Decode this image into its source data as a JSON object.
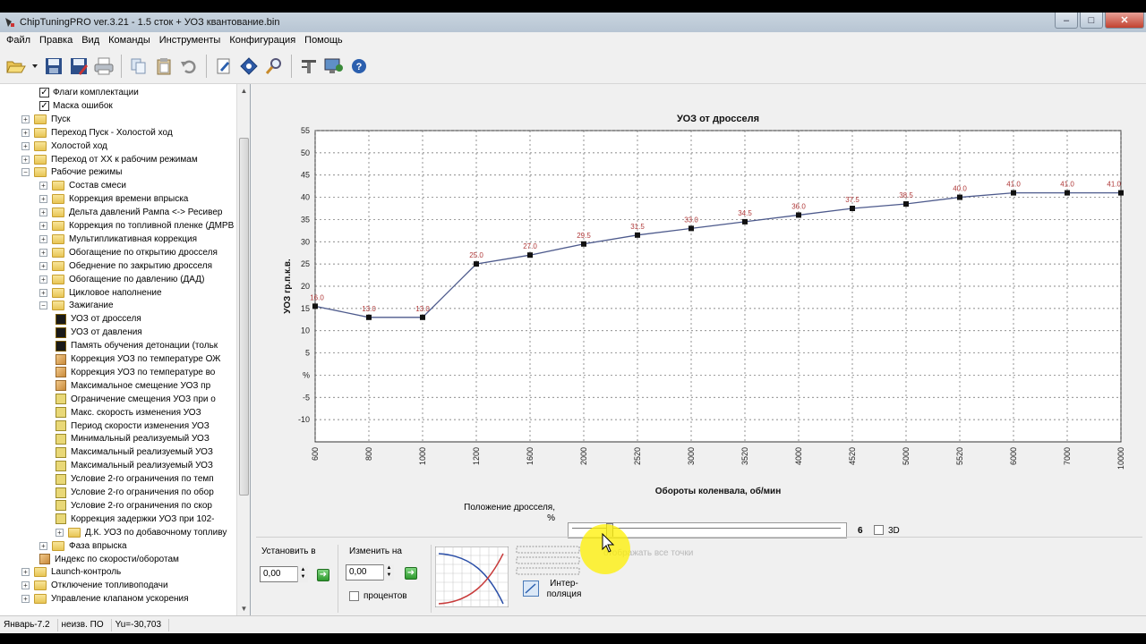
{
  "window": {
    "title": "ChipTuningPRO ver.3.21 - 1.5 сток + УОЗ квантование.bin",
    "min_label": "–",
    "max_label": "□",
    "close_label": "✕"
  },
  "menu": [
    "Файл",
    "Правка",
    "Вид",
    "Команды",
    "Инструменты",
    "Конфигурация",
    "Помощь"
  ],
  "toolbar": {
    "icons": [
      "open-icon",
      "save-icon",
      "save-as-icon",
      "print-icon",
      "copy-icon",
      "paste-icon",
      "undo-icon",
      "edit-icon",
      "diamond-icon",
      "search-icon",
      "tools-icon",
      "monitor-icon",
      "help-icon"
    ]
  },
  "tree": {
    "items": [
      {
        "level": 2,
        "kind": "check",
        "label": "Флаги комплектации",
        "expander": ""
      },
      {
        "level": 2,
        "kind": "check",
        "label": "Маска ошибок",
        "expander": ""
      },
      {
        "level": 1,
        "kind": "folder",
        "label": "Пуск",
        "expander": "+"
      },
      {
        "level": 1,
        "kind": "folder",
        "label": "Переход Пуск - Холостой ход",
        "expander": "+"
      },
      {
        "level": 1,
        "kind": "folder",
        "label": "Холостой ход",
        "expander": "+"
      },
      {
        "level": 1,
        "kind": "folder",
        "label": "Переход от ХХ к рабочим режимам",
        "expander": "+"
      },
      {
        "level": 1,
        "kind": "folder",
        "label": "Рабочие режимы",
        "expander": "−"
      },
      {
        "level": 2,
        "kind": "folder",
        "label": "Состав смеси",
        "expander": "+"
      },
      {
        "level": 2,
        "kind": "folder",
        "label": "Коррекция времени впрыска",
        "expander": "+"
      },
      {
        "level": 2,
        "kind": "folder",
        "label": "Дельта давлений Рампа <-> Ресивер",
        "expander": "+"
      },
      {
        "level": 2,
        "kind": "folder",
        "label": "Коррекция по топливной пленке (ДМРВ",
        "expander": "+"
      },
      {
        "level": 2,
        "kind": "folder",
        "label": "Мультипликативная коррекция",
        "expander": "+"
      },
      {
        "level": 2,
        "kind": "folder",
        "label": "Обогащение по открытию дросселя",
        "expander": "+"
      },
      {
        "level": 2,
        "kind": "folder",
        "label": "Обеднение по закрытию дросселя",
        "expander": "+"
      },
      {
        "level": 2,
        "kind": "folder",
        "label": "Обогащение по давлению (ДАД)",
        "expander": "+"
      },
      {
        "level": 2,
        "kind": "folder",
        "label": "Цикловое наполнение",
        "expander": "+"
      },
      {
        "level": 2,
        "kind": "folder",
        "label": "Зажигание",
        "expander": "−"
      },
      {
        "level": 3,
        "kind": "map",
        "label": "УОЗ от дросселя",
        "expander": ""
      },
      {
        "level": 3,
        "kind": "map",
        "label": "УОЗ от давления",
        "expander": ""
      },
      {
        "level": 3,
        "kind": "map",
        "label": "Память обучения детонации (тольк",
        "expander": ""
      },
      {
        "level": 3,
        "kind": "table",
        "label": "Коррекция УОЗ по температуре ОЖ",
        "expander": ""
      },
      {
        "level": 3,
        "kind": "table",
        "label": "Коррекция УОЗ по температуре во",
        "expander": ""
      },
      {
        "level": 3,
        "kind": "table",
        "label": "Максимальное смещение УОЗ пр",
        "expander": ""
      },
      {
        "level": 3,
        "kind": "const",
        "label": "Ограничение смещения УОЗ при о",
        "expander": ""
      },
      {
        "level": 3,
        "kind": "const",
        "label": "Макс. скорость изменения УОЗ",
        "expander": ""
      },
      {
        "level": 3,
        "kind": "const",
        "label": "Период скорости изменения УОЗ",
        "expander": ""
      },
      {
        "level": 3,
        "kind": "const",
        "label": "Минимальный реализуемый УОЗ",
        "expander": ""
      },
      {
        "level": 3,
        "kind": "const",
        "label": "Максимальный реализуемый УОЗ",
        "expander": ""
      },
      {
        "level": 3,
        "kind": "const",
        "label": "Максимальный реализуемый УОЗ",
        "expander": ""
      },
      {
        "level": 3,
        "kind": "const",
        "label": "Условие 2-го ограничения по темп",
        "expander": ""
      },
      {
        "level": 3,
        "kind": "const",
        "label": "Условие 2-го ограничения по обор",
        "expander": ""
      },
      {
        "level": 3,
        "kind": "const",
        "label": "Условие 2-го ограничения по скор",
        "expander": ""
      },
      {
        "level": 3,
        "kind": "const",
        "label": "Коррекция задержки УОЗ при 102-",
        "expander": ""
      },
      {
        "level": 3,
        "kind": "folder",
        "label": "Д.К. УОЗ по добавочному топливу",
        "expander": "+"
      },
      {
        "level": 2,
        "kind": "folder",
        "label": "Фаза впрыска",
        "expander": "+"
      },
      {
        "level": 2,
        "kind": "table",
        "label": "Индекс по скорости/оборотам",
        "expander": ""
      },
      {
        "level": 1,
        "kind": "folder",
        "label": "Launch-контроль",
        "expander": "+"
      },
      {
        "level": 1,
        "kind": "folder",
        "label": "Отключение топливоподачи",
        "expander": "+"
      },
      {
        "level": 1,
        "kind": "folder",
        "label": "Управление клапаном ускорения",
        "expander": "+"
      }
    ]
  },
  "chart_data": {
    "type": "line",
    "title": "УОЗ от дросселя",
    "xlabel": "Обороты коленвала, об/мин",
    "ylabel": "УОЗ гр.п.к.в.",
    "categories": [
      "600",
      "800",
      "1000",
      "1200",
      "1600",
      "2000",
      "2520",
      "3000",
      "3520",
      "4000",
      "4520",
      "5000",
      "5520",
      "6000",
      "7000",
      "10000"
    ],
    "values": [
      15.5,
      13.0,
      13.0,
      25.0,
      27.0,
      29.5,
      31.5,
      33.0,
      34.5,
      36.0,
      37.5,
      38.5,
      40.0,
      41.0,
      41.0,
      41.0
    ],
    "point_labels": [
      "16.0",
      "13.0",
      "13.0",
      "25.0",
      "27.0",
      "29.5",
      "31.5",
      "33.0",
      "34.5",
      "36.0",
      "37.5",
      "38.5",
      "40.0",
      "41.0",
      "41.0",
      "41.0"
    ],
    "yticks": [
      "55",
      "50",
      "45",
      "40",
      "35",
      "30",
      "25",
      "20",
      "15",
      "10",
      "5",
      "%",
      "-5",
      "-10"
    ],
    "ylim": [
      -15,
      55
    ],
    "grid": true,
    "line_color": "#4d5a8c",
    "label_color": "#b03a3a"
  },
  "throttle": {
    "label_line1": "Положение дросселя,",
    "label_line2": "%",
    "value": "6",
    "check_3d": "3D",
    "position_fraction": 0.13
  },
  "controls": {
    "set_label": "Установить в",
    "set_value": "0,00",
    "change_label": "Изменить на",
    "change_value": "0,00",
    "percent_label": "процентов",
    "show_all_label": "отображать все точки",
    "interp_label_1": "Интер-",
    "interp_label_2": "поляция"
  },
  "status": {
    "s1": "Январь-7.2",
    "s2": "неизв. ПО",
    "s3": "Yu=-30,703"
  }
}
